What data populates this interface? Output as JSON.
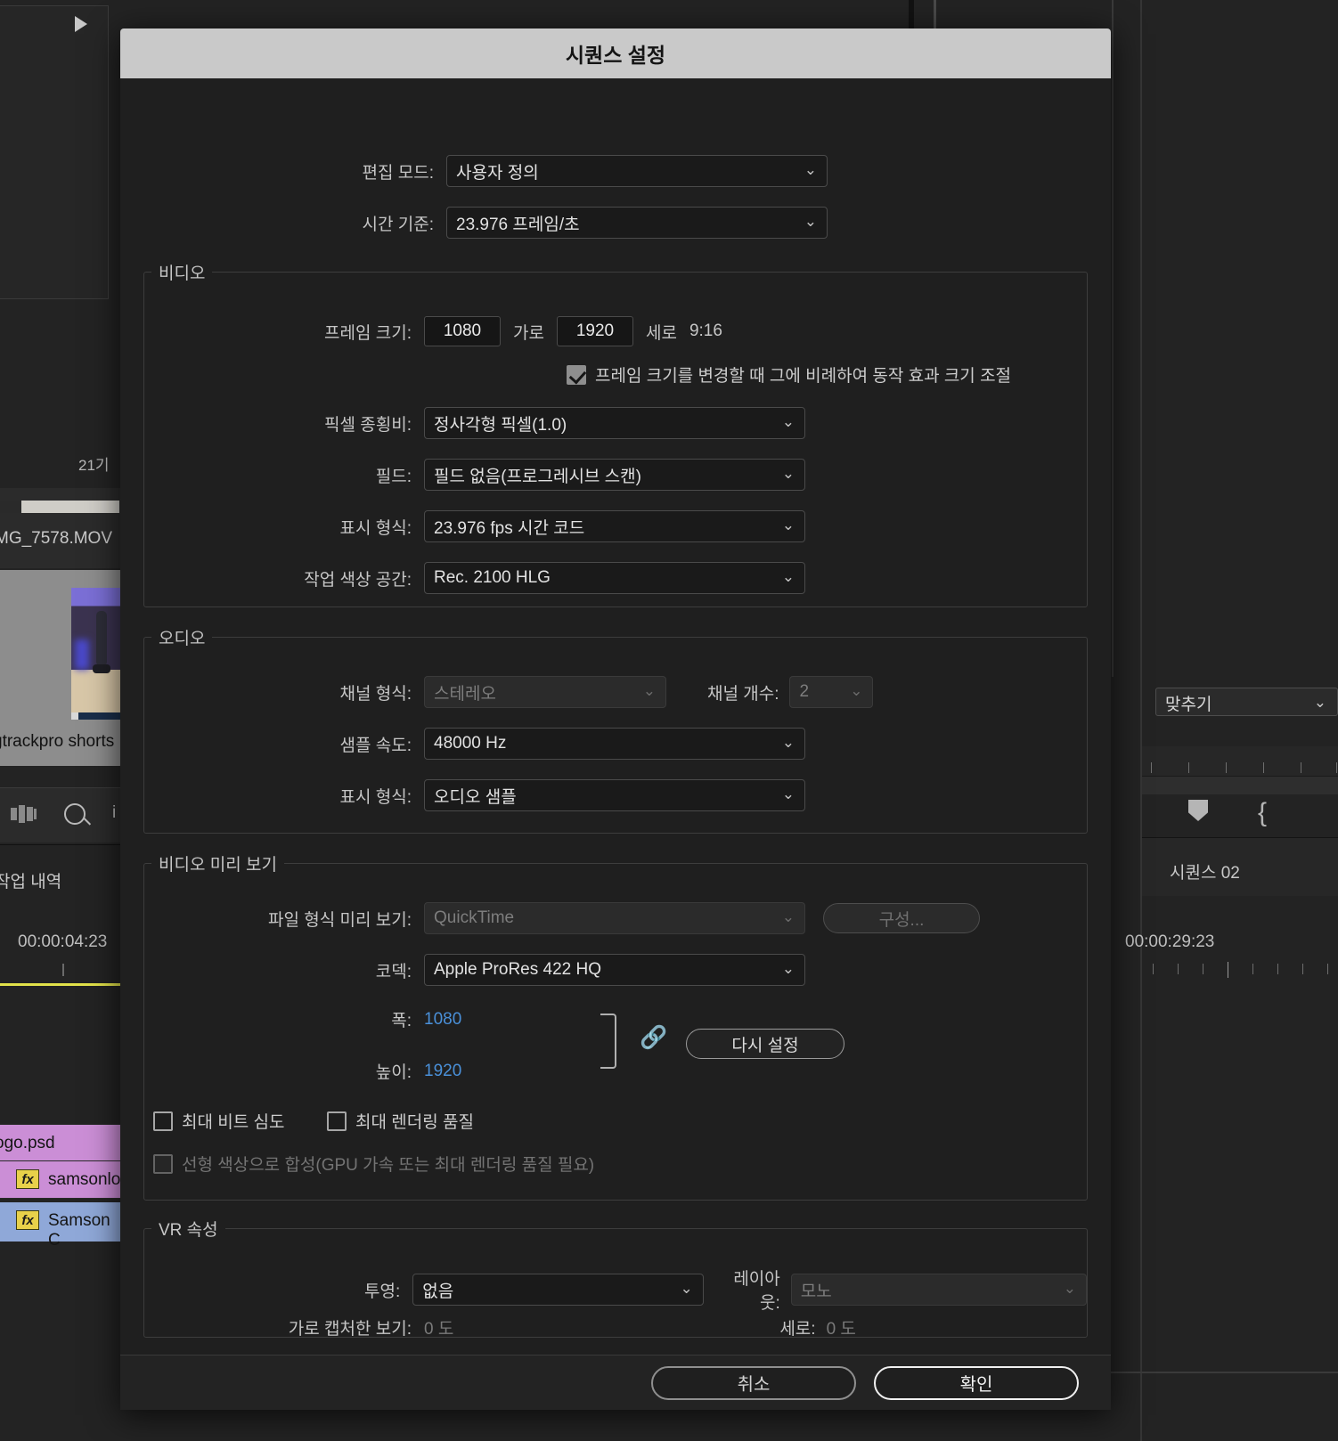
{
  "background": {
    "top_left_play": "play-triangle",
    "clip_count_label": "21기",
    "source_file": "MG_7578.MOV",
    "project_clip": "gtrackpro shorts",
    "history_panel": "작업 내역",
    "timecode_left": "00:00:04:23",
    "timecode_right": "00:00:29:23",
    "fit_dropdown": "맞추기",
    "sequence_tab": "시퀀스 02",
    "timeline_clips": [
      {
        "name": "ogo.psd",
        "has_fx": false
      },
      {
        "name": "samsonlo",
        "has_fx": true,
        "fx": "fx"
      },
      {
        "name": "Samson C",
        "has_fx": true,
        "fx": "fx"
      }
    ]
  },
  "dialog": {
    "title": "시퀀스 설정",
    "edit_mode": {
      "label": "편집 모드:",
      "value": "사용자 정의"
    },
    "timebase": {
      "label": "시간 기준:",
      "value": "23.976  프레임/초"
    },
    "video": {
      "legend": "비디오",
      "frame_size": {
        "label": "프레임 크기:",
        "width_value": "1080",
        "width_unit": "가로",
        "height_value": "1920",
        "height_unit": "세로",
        "ratio": "9:16"
      },
      "scale_checkbox": {
        "label": "프레임 크기를 변경할 때 그에 비례하여 동작 효과 크기 조절",
        "checked": true
      },
      "pixel_aspect": {
        "label": "픽셀 종횡비:",
        "value": "정사각형 픽셀(1.0)"
      },
      "fields": {
        "label": "필드:",
        "value": "필드 없음(프로그레시브 스캔)"
      },
      "display_format": {
        "label": "표시 형식:",
        "value": "23.976 fps 시간 코드"
      },
      "color_space": {
        "label": "작업 색상 공간:",
        "value": "Rec. 2100 HLG"
      }
    },
    "audio": {
      "legend": "오디오",
      "channel_format": {
        "label": "채널 형식:",
        "value": "스테레오",
        "disabled": true
      },
      "channel_count": {
        "label": "채널 개수:",
        "value": "2",
        "disabled": true
      },
      "sample_rate": {
        "label": "샘플 속도:",
        "value": "48000 Hz"
      },
      "display_format": {
        "label": "표시 형식:",
        "value": "오디오 샘플"
      }
    },
    "video_preview": {
      "legend": "비디오 미리 보기",
      "file_format": {
        "label": "파일 형식 미리 보기:",
        "value": "QuickTime",
        "disabled": true
      },
      "configure_button": {
        "label": "구성...",
        "disabled": true
      },
      "codec": {
        "label": "코덱:",
        "value": "Apple ProRes 422 HQ"
      },
      "width": {
        "label": "폭:",
        "value": "1080"
      },
      "height": {
        "label": "높이:",
        "value": "1920"
      },
      "link_icon": "link-chain-icon",
      "reset_button": "다시 설정",
      "max_bit_depth": {
        "label": "최대 비트 심도",
        "checked": false
      },
      "max_render_quality": {
        "label": "최대 렌더링 품질",
        "checked": false
      },
      "linear_color": {
        "label": "선형 색상으로 합성(GPU 가속 또는 최대 렌더링 품질 필요)",
        "checked": false,
        "disabled": true
      }
    },
    "vr": {
      "legend": "VR 속성",
      "projection": {
        "label": "투영:",
        "value": "없음"
      },
      "layout": {
        "label": "레이아웃:",
        "value": "모노",
        "disabled": true
      },
      "horizontal_capture": {
        "label": "가로 캡처한 보기:",
        "value": "0 도",
        "disabled": true
      },
      "vertical_capture": {
        "label": "세로:",
        "value": "0 도",
        "disabled": true
      }
    },
    "footer": {
      "cancel": "취소",
      "ok": "확인"
    }
  },
  "colors": {
    "accent_blue": "#4a90d9",
    "title_bar": "#c9c9c9",
    "dialog_bg": "#1f1f1f"
  }
}
